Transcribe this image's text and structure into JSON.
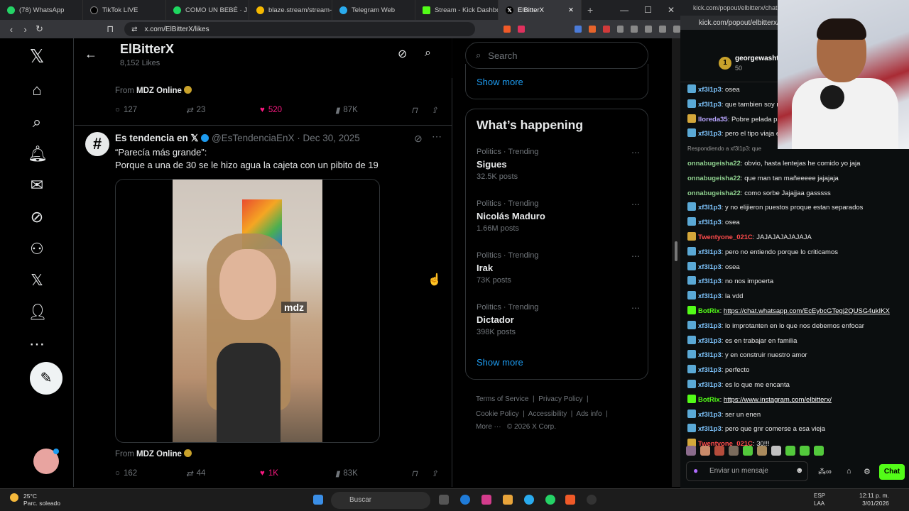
{
  "browser": {
    "tabs": [
      {
        "label": "(78) WhatsApp",
        "color": "#25d366"
      },
      {
        "label": "TikTok LIVE",
        "color": "#000000"
      },
      {
        "label": "COMO UN BEBÉ · J",
        "color": "#1ed760"
      },
      {
        "label": "blaze.stream/stream-se",
        "color": "#f5b800"
      },
      {
        "label": "Telegram Web",
        "color": "#2aabee"
      },
      {
        "label": "Stream - Kick Dashboa",
        "color": "#53fc18"
      },
      {
        "label": "ElBitterX",
        "color": "#000000"
      }
    ],
    "url": "x.com/ElBitterX/likes"
  },
  "profile": {
    "name": "ElBitterX",
    "subtitle": "8,152 Likes"
  },
  "tweet1": {
    "from_label": "From",
    "source": "MDZ Online",
    "replies": "127",
    "reposts": "23",
    "likes": "520",
    "views": "87K"
  },
  "tweet2": {
    "author": "Es tendencia en 𝕏",
    "handle": "@EsTendenciaEnX · Dec 30, 2025",
    "text_line1": "“Parecía más grande”:",
    "text_line2": "Porque a una de 30 se le hizo agua la cajeta con un pibito de 19",
    "watermark": "mdz",
    "from_label": "From",
    "source": "MDZ Online",
    "replies": "162",
    "reposts": "44",
    "likes": "1K",
    "views": "83K"
  },
  "sidebar": {
    "search_placeholder": "Search",
    "show_more": "Show more",
    "whats_happening": "What’s happening",
    "trends": [
      {
        "category": "Politics · Trending",
        "name": "Sigues",
        "count": "32.5K posts"
      },
      {
        "category": "Politics · Trending",
        "name": "Nicolás Maduro",
        "count": "1.66M posts"
      },
      {
        "category": "Politics · Trending",
        "name": "Irak",
        "count": "73K posts"
      },
      {
        "category": "Politics · Trending",
        "name": "Dictador",
        "count": "398K posts"
      }
    ],
    "footer": {
      "terms": "Terms of Service",
      "privacy": "Privacy Policy",
      "cookie": "Cookie Policy",
      "accessibility": "Accessibility",
      "ads": "Ads info",
      "more": "More ···",
      "copyright": "© 2026 X Corp."
    }
  },
  "kick": {
    "title": "kick.com/popout/elbitterx/chat - K",
    "url": "kick.com/popout/elbitterx/",
    "pinned_user": "georgewasht",
    "pinned_points": "50",
    "messages": [
      {
        "user": "xf3l1p3",
        "text": "osea",
        "color": "#7fc6ff",
        "badge": "#5aa9d6"
      },
      {
        "user": "xf3l1p3",
        "text": "que tambien soy n",
        "color": "#7fc6ff",
        "badge": "#5aa9d6"
      },
      {
        "user": "lloreda35",
        "text": "Pobre pelada pa",
        "color": "#b9a6ff",
        "badge": "#d4a73a"
      },
      {
        "user": "xf3l1p3",
        "text": "pero el tipo viaja e",
        "color": "#7fc6ff",
        "badge": "#5aa9d6"
      },
      {
        "reply": "Respondiendo a xf3l1p3: que"
      },
      {
        "user": "onnabugeisha22",
        "text": "obvio, hasta lentejas he comido yo jaja",
        "color": "#8fd18f",
        "badge": ""
      },
      {
        "user": "onnabugeisha22",
        "text": "que man tan mañeeeee jajajaja",
        "color": "#8fd18f",
        "badge": ""
      },
      {
        "user": "onnabugeisha22",
        "text": "como sorbe Jajajjaa gasssss",
        "color": "#8fd18f",
        "badge": ""
      },
      {
        "user": "xf3l1p3",
        "text": "y no elijieron puestos proque estan separados",
        "color": "#7fc6ff",
        "badge": "#5aa9d6"
      },
      {
        "user": "xf3l1p3",
        "text": "osea",
        "color": "#7fc6ff",
        "badge": "#5aa9d6"
      },
      {
        "user": "Twentyone_021C",
        "text": "JAJAJAJAJAJAJA",
        "color": "#ff4b4b",
        "badge": "#d4a73a"
      },
      {
        "user": "xf3l1p3",
        "text": "pero no entiendo porque lo criticamos",
        "color": "#7fc6ff",
        "badge": "#5aa9d6"
      },
      {
        "user": "xf3l1p3",
        "text": "osea",
        "color": "#7fc6ff",
        "badge": "#5aa9d6"
      },
      {
        "user": "xf3l1p3",
        "text": "no nos impoerta",
        "color": "#7fc6ff",
        "badge": "#5aa9d6"
      },
      {
        "user": "xf3l1p3",
        "text": "la vdd",
        "color": "#7fc6ff",
        "badge": "#5aa9d6"
      },
      {
        "user": "BotRix",
        "text": "",
        "link": "https://chat.whatsapp.com/EcEybcGTegj2QUSG4ukIKX",
        "color": "#53fc18",
        "badge": "#53fc18"
      },
      {
        "user": "xf3l1p3",
        "text": "lo improtanten en lo que nos debemos enfocar",
        "color": "#7fc6ff",
        "badge": "#5aa9d6"
      },
      {
        "user": "xf3l1p3",
        "text": "es en trabajar en familia",
        "color": "#7fc6ff",
        "badge": "#5aa9d6"
      },
      {
        "user": "xf3l1p3",
        "text": "y en construir nuestro amor",
        "color": "#7fc6ff",
        "badge": "#5aa9d6"
      },
      {
        "user": "xf3l1p3",
        "text": "perfecto",
        "color": "#7fc6ff",
        "badge": "#5aa9d6"
      },
      {
        "user": "xf3l1p3",
        "text": "es lo que me encanta",
        "color": "#7fc6ff",
        "badge": "#5aa9d6"
      },
      {
        "user": "BotRix",
        "text": "",
        "link": "https://www.instagram.com/elbitterx/",
        "color": "#53fc18",
        "badge": "#53fc18"
      },
      {
        "user": "xf3l1p3",
        "text": "ser un enen",
        "color": "#7fc6ff",
        "badge": "#5aa9d6"
      },
      {
        "user": "xf3l1p3",
        "text": "pero que gnr comerse a esa vieja",
        "color": "#7fc6ff",
        "badge": "#5aa9d6"
      },
      {
        "user": "Twentyone_021C",
        "text": "30!!!",
        "color": "#ff4b4b",
        "badge": "#d4a73a"
      }
    ],
    "input_placeholder": "Enviar un mensaje",
    "chat_button": "Chat"
  },
  "taskbar": {
    "temp": "25°C",
    "weather": "Parc. soleado",
    "search": "Buscar",
    "lang1": "ESP",
    "lang2": "LAA",
    "time": "12:11 p. m.",
    "date": "3/01/2026"
  }
}
